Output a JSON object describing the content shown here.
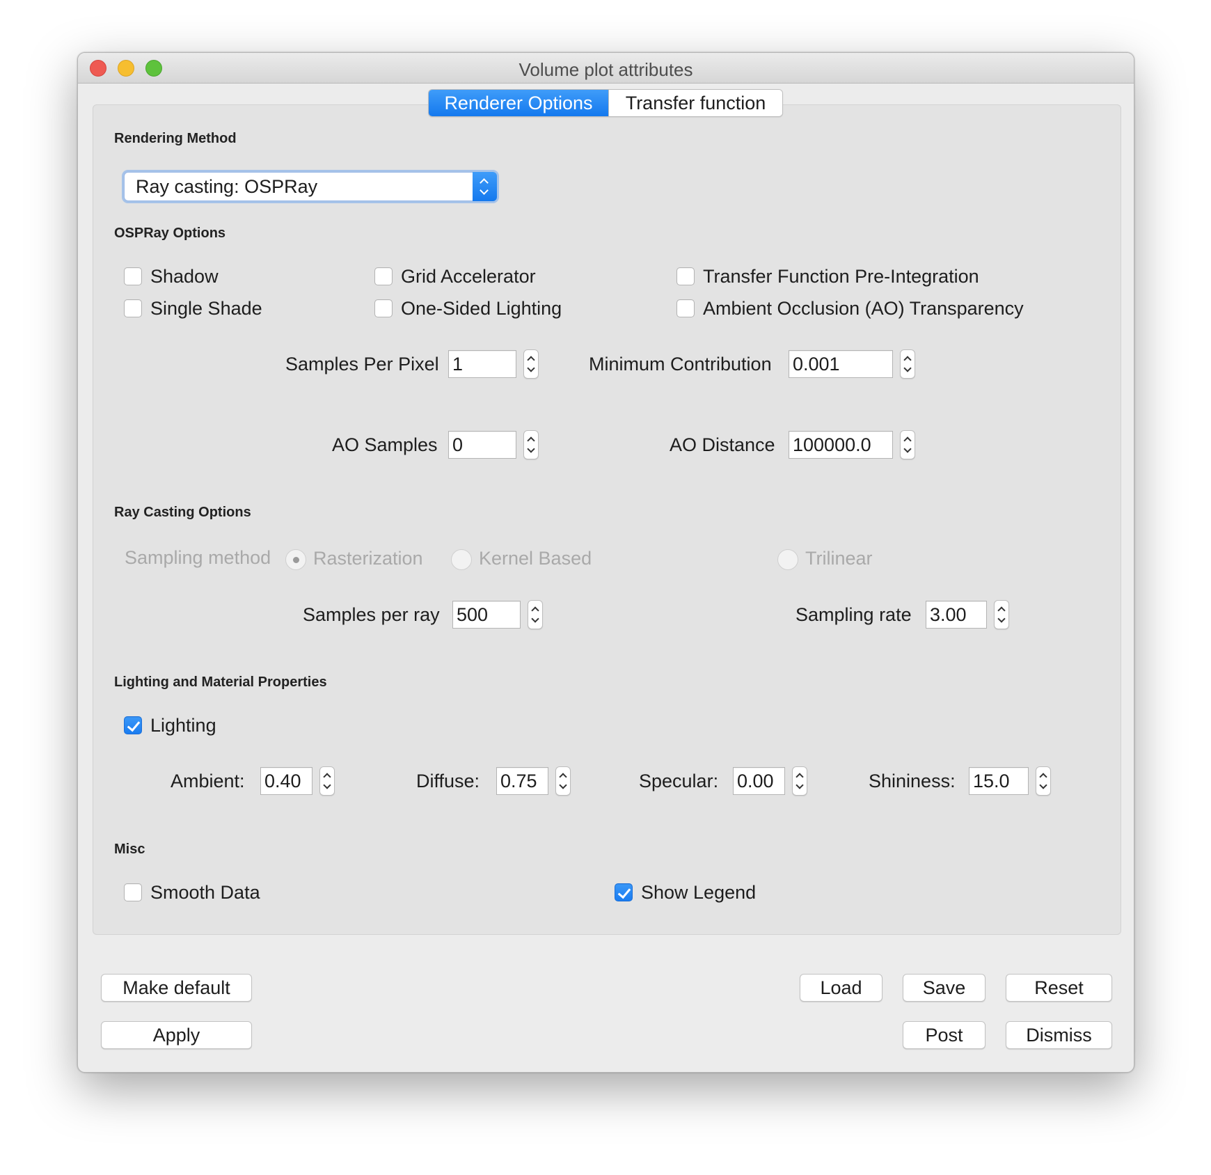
{
  "window": {
    "title": "Volume plot attributes"
  },
  "tabs": [
    {
      "label": "Renderer Options",
      "active": true
    },
    {
      "label": "Transfer function",
      "active": false
    }
  ],
  "rendering_method": {
    "heading": "Rendering Method",
    "selected": "Ray casting: OSPRay"
  },
  "ospray": {
    "heading": "OSPRay Options",
    "checkboxes": [
      {
        "label": "Shadow",
        "checked": false
      },
      {
        "label": "Grid Accelerator",
        "checked": false
      },
      {
        "label": "Transfer Function Pre-Integration",
        "checked": false
      },
      {
        "label": "Single Shade",
        "checked": false
      },
      {
        "label": "One-Sided Lighting",
        "checked": false
      },
      {
        "label": "Ambient Occlusion (AO) Transparency",
        "checked": false
      }
    ],
    "samples_per_pixel": {
      "label": "Samples Per Pixel",
      "value": "1"
    },
    "min_contribution": {
      "label": "Minimum Contribution",
      "value": "0.001"
    },
    "ao_samples": {
      "label": "AO Samples",
      "value": "0"
    },
    "ao_distance": {
      "label": "AO Distance",
      "value": "100000.0"
    }
  },
  "raycasting": {
    "heading": "Ray Casting Options",
    "sampling_method_label": "Sampling method",
    "options": [
      {
        "label": "Rasterization",
        "selected": true
      },
      {
        "label": "Kernel Based",
        "selected": false
      },
      {
        "label": "Trilinear",
        "selected": false
      }
    ],
    "samples_per_ray": {
      "label": "Samples per ray",
      "value": "500"
    },
    "sampling_rate": {
      "label": "Sampling rate",
      "value": "3.00"
    }
  },
  "lighting": {
    "heading": "Lighting and Material Properties",
    "lighting_checkbox": {
      "label": "Lighting",
      "checked": true
    },
    "ambient": {
      "label": "Ambient:",
      "value": "0.40"
    },
    "diffuse": {
      "label": "Diffuse:",
      "value": "0.75"
    },
    "specular": {
      "label": "Specular:",
      "value": "0.00"
    },
    "shininess": {
      "label": "Shininess:",
      "value": "15.0"
    }
  },
  "misc": {
    "heading": "Misc",
    "smooth_data": {
      "label": "Smooth Data",
      "checked": false
    },
    "show_legend": {
      "label": "Show Legend",
      "checked": true
    }
  },
  "buttons": {
    "make_default": "Make default",
    "apply": "Apply",
    "load": "Load",
    "save": "Save",
    "reset": "Reset",
    "post": "Post",
    "dismiss": "Dismiss"
  },
  "colors": {
    "accent": "#1a7cf0",
    "close": "#ee5a52",
    "minimize": "#f6be30",
    "maximize": "#5ec23c"
  }
}
